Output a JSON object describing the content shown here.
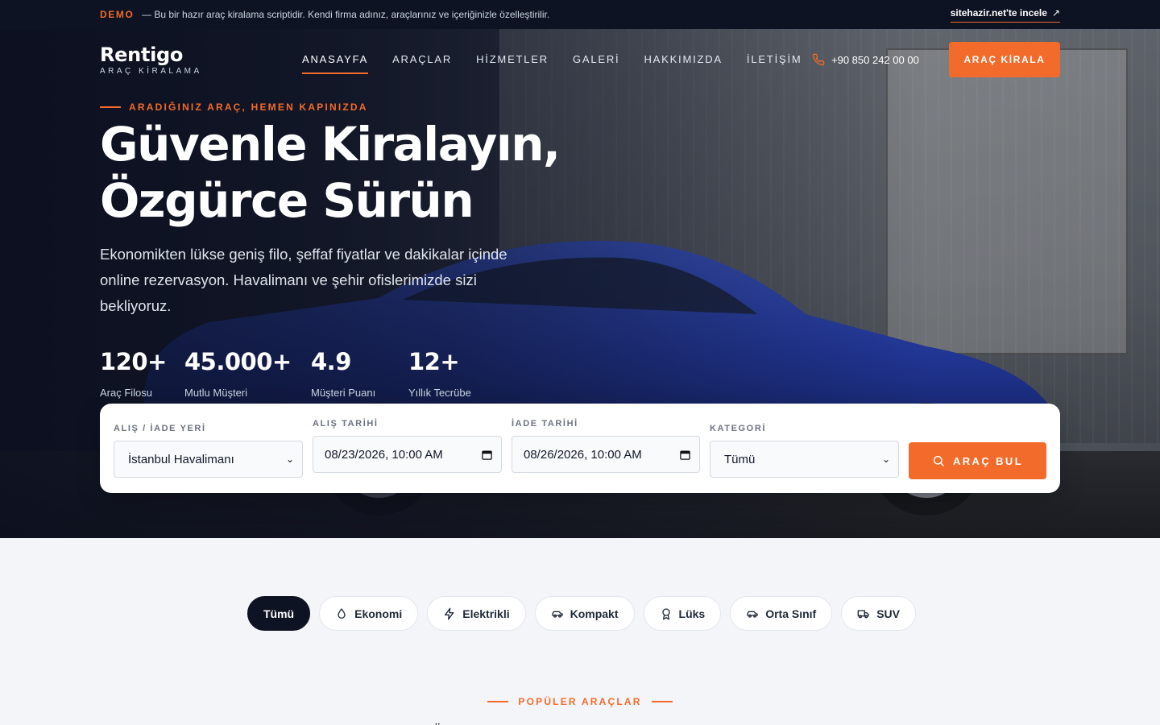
{
  "topbar": {
    "demo_tag": "DEMO",
    "demo_text": "— Bu bir hazır araç kiralama scriptidir. Kendi firma adınız, araçlarınız ve içeriğinizle özelleştirilir.",
    "link_label": "sitehazir.net'te incele",
    "link_icon": "↗"
  },
  "brand": {
    "name": "Rentigo",
    "tagline": "ARAÇ KİRALAMA"
  },
  "nav": {
    "items": [
      {
        "label": "ANASAYFA"
      },
      {
        "label": "ARAÇLAR"
      },
      {
        "label": "HİZMETLER"
      },
      {
        "label": "GALERİ"
      },
      {
        "label": "HAKKIMIZDA"
      },
      {
        "label": "İLETİŞİM"
      }
    ],
    "active_index": 0,
    "phone": "+90 850 242 00 00",
    "cta_label": "ARAÇ KİRALA"
  },
  "hero": {
    "eyebrow": "ARADIĞINIZ ARAÇ, HEMEN KAPINIZDA",
    "title_line1": "Güvenle Kiralayın,",
    "title_line2": "Özgürce Sürün",
    "lead": "Ekonomikten lükse geniş filo, şeffaf fiyatlar ve dakikalar içinde online rezervasyon. Havalimanı ve şehir ofislerimizde sizi bekliyoruz.",
    "stats": [
      {
        "value": "120+",
        "label": "Araç Filosu"
      },
      {
        "value": "45.000+",
        "label": "Mutlu Müşteri"
      },
      {
        "value": "4.9",
        "label": "Müşteri Puanı"
      },
      {
        "value": "12+",
        "label": "Yıllık Tecrübe"
      }
    ]
  },
  "search": {
    "location_label": "ALIŞ / İADE YERİ",
    "location_value": "İstanbul Havalimanı",
    "pickup_label": "ALIŞ TARİHİ",
    "pickup_value": "08/23/2026, 10:00 AM",
    "return_label": "İADE TARİHİ",
    "return_value": "08/26/2026, 10:00 AM",
    "category_label": "KATEGORİ",
    "category_value": "Tümü",
    "button_label": "ARAÇ BUL"
  },
  "filters": {
    "items": [
      {
        "label": "Tümü",
        "icon": ""
      },
      {
        "label": "Ekonomi",
        "icon": "drop-icon"
      },
      {
        "label": "Elektrikli",
        "icon": "bolt-icon"
      },
      {
        "label": "Kompakt",
        "icon": "car-icon"
      },
      {
        "label": "Lüks",
        "icon": "award-icon"
      },
      {
        "label": "Orta Sınıf",
        "icon": "car-icon"
      },
      {
        "label": "SUV",
        "icon": "truck-icon"
      }
    ],
    "active_index": 0
  },
  "section": {
    "eyebrow": "POPÜLER ARAÇLAR"
  },
  "colors": {
    "accent": "#f26b2a",
    "dark": "#0d1322"
  }
}
